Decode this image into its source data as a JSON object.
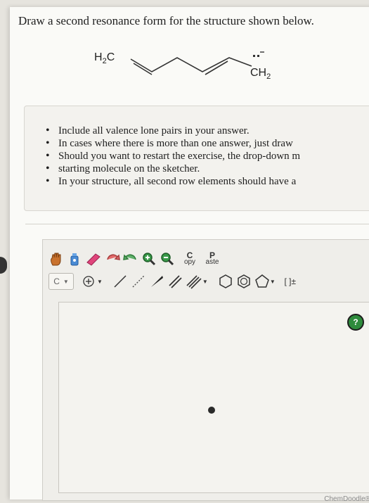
{
  "question": {
    "text": "Draw a second resonance form for the structure shown below."
  },
  "molecule": {
    "left_label_main": "H",
    "left_label_sub": "2",
    "left_label_end": "C",
    "right_label_main": "CH",
    "right_label_sub": "2"
  },
  "instructions": [
    "Include all valence lone pairs in your answer.",
    "In cases where there is more than one answer, just draw",
    "Should you want to restart the exercise, the drop-down m",
    "starting molecule on the sketcher.",
    "In your structure, all second row elements should have a"
  ],
  "toolbar": {
    "copy_top": "C",
    "copy_bottom": "opy",
    "paste_top": "P",
    "paste_bottom": "aste",
    "element_label": "C",
    "bracket_label": "[ ]±"
  },
  "sketcher": {
    "help_label": "?",
    "brand": "ChemDoodle®"
  },
  "colors": {
    "help_green": "#2e8b3c",
    "eraser_pink": "#e0457b",
    "zoom_green": "#3a9a4a"
  }
}
